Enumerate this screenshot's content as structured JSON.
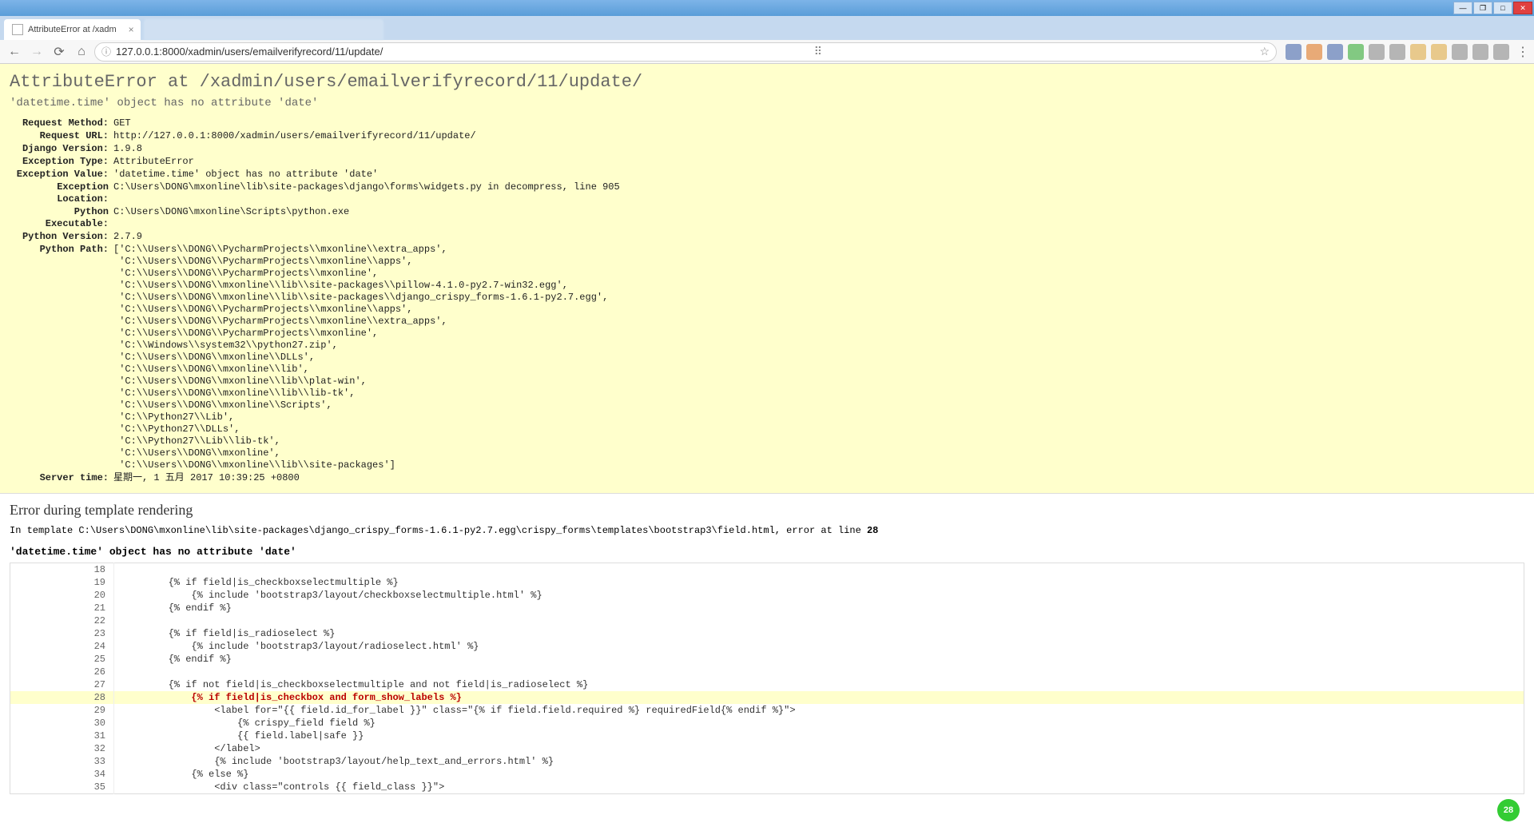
{
  "browser": {
    "tab_title": "AttributeError at /xadm",
    "url": "127.0.0.1:8000/xadmin/users/emailverifyrecord/11/update/"
  },
  "error": {
    "title": "AttributeError at /xadmin/users/emailverifyrecord/11/update/",
    "exception_value": "'datetime.time' object has no attribute 'date'"
  },
  "meta": {
    "request_method_label": "Request Method:",
    "request_method": "GET",
    "request_url_label": "Request URL:",
    "request_url": "http://127.0.0.1:8000/xadmin/users/emailverifyrecord/11/update/",
    "django_version_label": "Django Version:",
    "django_version": "1.9.8",
    "exception_type_label": "Exception Type:",
    "exception_type": "AttributeError",
    "exception_value_label": "Exception Value:",
    "exception_value": "'datetime.time' object has no attribute 'date'",
    "exception_location_label": "Exception Location:",
    "exception_location": "C:\\Users\\DONG\\mxonline\\lib\\site-packages\\django\\forms\\widgets.py in decompress, line 905",
    "python_executable_label": "Python Executable:",
    "python_executable": "C:\\Users\\DONG\\mxonline\\Scripts\\python.exe",
    "python_version_label": "Python Version:",
    "python_version": "2.7.9",
    "python_path_label": "Python Path:",
    "python_path": "['C:\\\\Users\\\\DONG\\\\PycharmProjects\\\\mxonline\\\\extra_apps',\n 'C:\\\\Users\\\\DONG\\\\PycharmProjects\\\\mxonline\\\\apps',\n 'C:\\\\Users\\\\DONG\\\\PycharmProjects\\\\mxonline',\n 'C:\\\\Users\\\\DONG\\\\mxonline\\\\lib\\\\site-packages\\\\pillow-4.1.0-py2.7-win32.egg',\n 'C:\\\\Users\\\\DONG\\\\mxonline\\\\lib\\\\site-packages\\\\django_crispy_forms-1.6.1-py2.7.egg',\n 'C:\\\\Users\\\\DONG\\\\PycharmProjects\\\\mxonline\\\\apps',\n 'C:\\\\Users\\\\DONG\\\\PycharmProjects\\\\mxonline\\\\extra_apps',\n 'C:\\\\Users\\\\DONG\\\\PycharmProjects\\\\mxonline',\n 'C:\\\\Windows\\\\system32\\\\python27.zip',\n 'C:\\\\Users\\\\DONG\\\\mxonline\\\\DLLs',\n 'C:\\\\Users\\\\DONG\\\\mxonline\\\\lib',\n 'C:\\\\Users\\\\DONG\\\\mxonline\\\\lib\\\\plat-win',\n 'C:\\\\Users\\\\DONG\\\\mxonline\\\\lib\\\\lib-tk',\n 'C:\\\\Users\\\\DONG\\\\mxonline\\\\Scripts',\n 'C:\\\\Python27\\\\Lib',\n 'C:\\\\Python27\\\\DLLs',\n 'C:\\\\Python27\\\\Lib\\\\lib-tk',\n 'C:\\\\Users\\\\DONG\\\\mxonline',\n 'C:\\\\Users\\\\DONG\\\\mxonline\\\\lib\\\\site-packages']",
    "server_time_label": "Server time:",
    "server_time": "星期一, 1 五月 2017 10:39:25 +0800"
  },
  "template_error": {
    "heading": "Error during template rendering",
    "location_prefix": "In template ",
    "location_path": "C:\\Users\\DONG\\mxonline\\lib\\site-packages\\django_crispy_forms-1.6.1-py2.7.egg\\crispy_forms\\templates\\bootstrap3\\field.html",
    "location_suffix": ", error at line ",
    "location_line": "28",
    "message": "'datetime.time' object has no attribute 'date'",
    "lines": [
      {
        "n": "18",
        "t": ""
      },
      {
        "n": "19",
        "t": "        {% if field|is_checkboxselectmultiple %}"
      },
      {
        "n": "20",
        "t": "            {% include 'bootstrap3/layout/checkboxselectmultiple.html' %}"
      },
      {
        "n": "21",
        "t": "        {% endif %}"
      },
      {
        "n": "22",
        "t": ""
      },
      {
        "n": "23",
        "t": "        {% if field|is_radioselect %}"
      },
      {
        "n": "24",
        "t": "            {% include 'bootstrap3/layout/radioselect.html' %}"
      },
      {
        "n": "25",
        "t": "        {% endif %}"
      },
      {
        "n": "26",
        "t": ""
      },
      {
        "n": "27",
        "t": "        {% if not field|is_checkboxselectmultiple and not field|is_radioselect %}"
      },
      {
        "n": "28",
        "t": "            {% if field|is_checkbox and form_show_labels %}",
        "hi": true
      },
      {
        "n": "29",
        "t": "                <label for=\"{{ field.id_for_label }}\" class=\"{% if field.field.required %} requiredField{% endif %}\">"
      },
      {
        "n": "30",
        "t": "                    {% crispy_field field %}"
      },
      {
        "n": "31",
        "t": "                    {{ field.label|safe }}"
      },
      {
        "n": "32",
        "t": "                </label>"
      },
      {
        "n": "33",
        "t": "                {% include 'bootstrap3/layout/help_text_and_errors.html' %}"
      },
      {
        "n": "34",
        "t": "            {% else %}"
      },
      {
        "n": "35",
        "t": "                <div class=\"controls {{ field_class }}\">"
      }
    ]
  },
  "badge": "28"
}
